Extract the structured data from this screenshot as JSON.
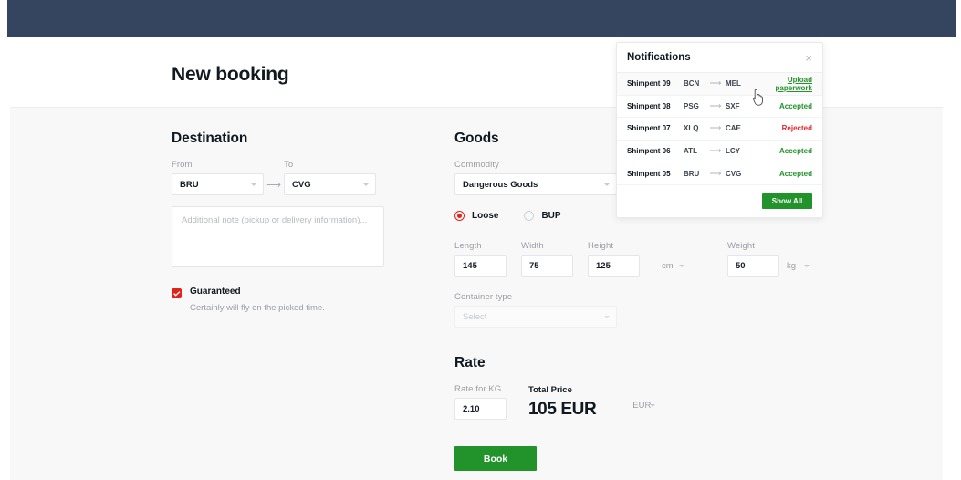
{
  "header": {
    "title": "New booking",
    "bar_color": "#36455f"
  },
  "colors": {
    "accent_red": "#e2231a",
    "accent_green": "#22922b",
    "reject_red": "#e8232a"
  },
  "destination": {
    "section_title": "Destination",
    "from_label": "From",
    "from_value": "BRU",
    "arrow": "⟶",
    "to_label": "To",
    "to_value": "CVG",
    "note_placeholder": "Additional note (pickup or delivery information)...",
    "guaranteed_label": "Guaranteed",
    "guaranteed_sub": "Certainly will fly on the picked time.",
    "guaranteed_checked": true
  },
  "goods": {
    "section_title": "Goods",
    "commodity_label": "Commodity",
    "commodity_value": "Dangerous Goods",
    "load_options": [
      {
        "label": "Loose",
        "selected": true
      },
      {
        "label": "BUP",
        "selected": false
      }
    ],
    "length_label": "Length",
    "length_value": "145",
    "width_label": "Width",
    "width_value": "75",
    "height_label": "Height",
    "height_value": "125",
    "dim_unit": "cm",
    "weight_label": "Weight",
    "weight_value": "50",
    "weight_unit": "kg",
    "container_label": "Container type",
    "container_placeholder": "Select"
  },
  "rate": {
    "section_title": "Rate",
    "rate_kg_label": "Rate for KG",
    "rate_kg_value": "2.10",
    "total_label": "Total Price",
    "total_value": "105 EUR",
    "currency_unit": "EUR",
    "book_label": "Book"
  },
  "notifications": {
    "title": "Notifications",
    "close_icon": "×",
    "show_all_label": "Show All",
    "rows": [
      {
        "name": "Shimpent 09",
        "from": "BCN",
        "arrow": "⟶",
        "to": "MEL",
        "status": "Upload paperwork",
        "status_type": "link",
        "hovered": true
      },
      {
        "name": "Shimpent 08",
        "from": "PSG",
        "arrow": "⟶",
        "to": "SXF",
        "status": "Accepted",
        "status_type": "accepted",
        "hovered": false
      },
      {
        "name": "Shimpent 07",
        "from": "XLQ",
        "arrow": "⟶",
        "to": "CAE",
        "status": "Rejected",
        "status_type": "rejected",
        "hovered": false
      },
      {
        "name": "Shimpent 06",
        "from": "ATL",
        "arrow": "⟶",
        "to": "LCY",
        "status": "Accepted",
        "status_type": "accepted",
        "hovered": false
      },
      {
        "name": "Shimpent 05",
        "from": "BRU",
        "arrow": "⟶",
        "to": "CVG",
        "status": "Accepted",
        "status_type": "accepted",
        "hovered": false
      }
    ]
  }
}
